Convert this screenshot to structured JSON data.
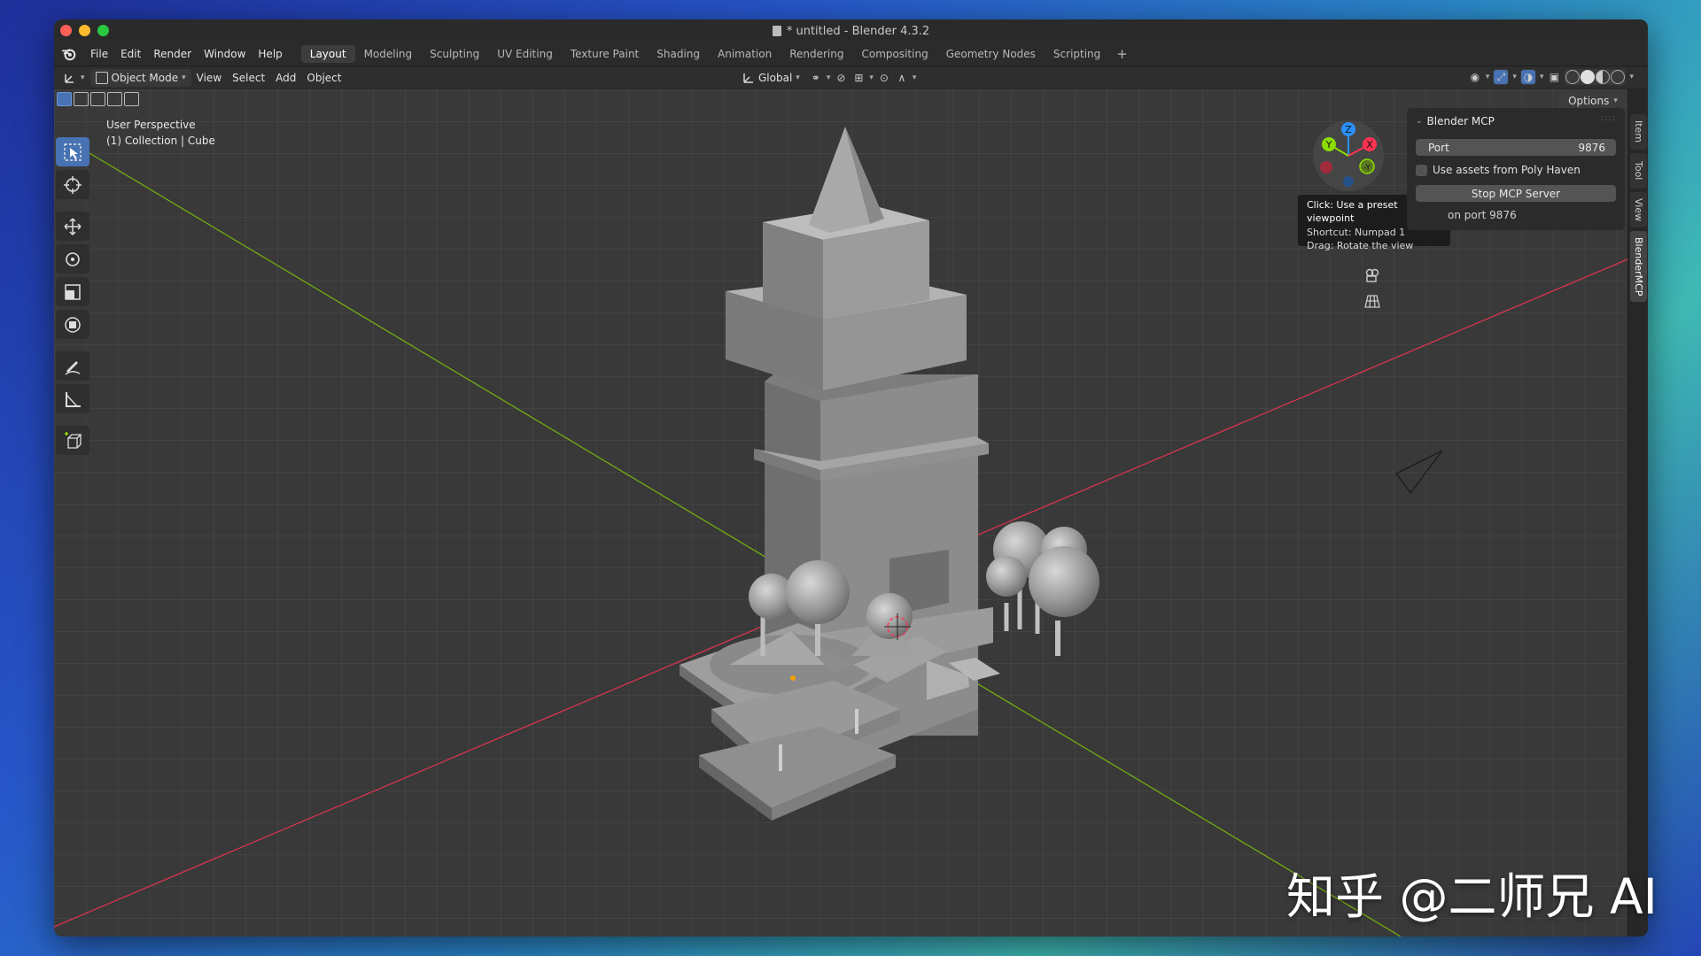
{
  "window": {
    "title": "* untitled - Blender 4.3.2"
  },
  "menubar": {
    "items": [
      "File",
      "Edit",
      "Render",
      "Window",
      "Help"
    ],
    "workspaces": [
      "Layout",
      "Modeling",
      "Sculpting",
      "UV Editing",
      "Texture Paint",
      "Shading",
      "Animation",
      "Rendering",
      "Compositing",
      "Geometry Nodes",
      "Scripting"
    ],
    "active_workspace": "Layout",
    "add_label": "+"
  },
  "header": {
    "mode": "Object Mode",
    "menus": [
      "View",
      "Select",
      "Add",
      "Object"
    ],
    "transform_orientation": "Global",
    "options_label": "Options"
  },
  "viewport": {
    "perspective_label": "User Perspective",
    "collection_label": "(1) Collection | Cube"
  },
  "gizmo": {
    "z": "Z",
    "x": "X",
    "y": "Y",
    "neg_y": "-Y"
  },
  "tooltip": {
    "title": "Click: Use a preset viewpoint",
    "shortcut": "Shortcut: Numpad 1",
    "drag": "Drag: Rotate the view"
  },
  "npanel": {
    "title": "Blender MCP",
    "port_label": "Port",
    "port_value": "9876",
    "poly_haven_label": "Use assets from Poly Haven",
    "stop_button": "Stop MCP Server",
    "status": "on port 9876"
  },
  "sidetabs": [
    "Item",
    "Tool",
    "View",
    "BlenderMCP"
  ],
  "watermark": "知乎 @二师兄 AI",
  "colors": {
    "accent": "#4772b3",
    "x_axis": "#ff3352",
    "y_axis": "#8bdc00",
    "z_axis": "#2890ff"
  }
}
